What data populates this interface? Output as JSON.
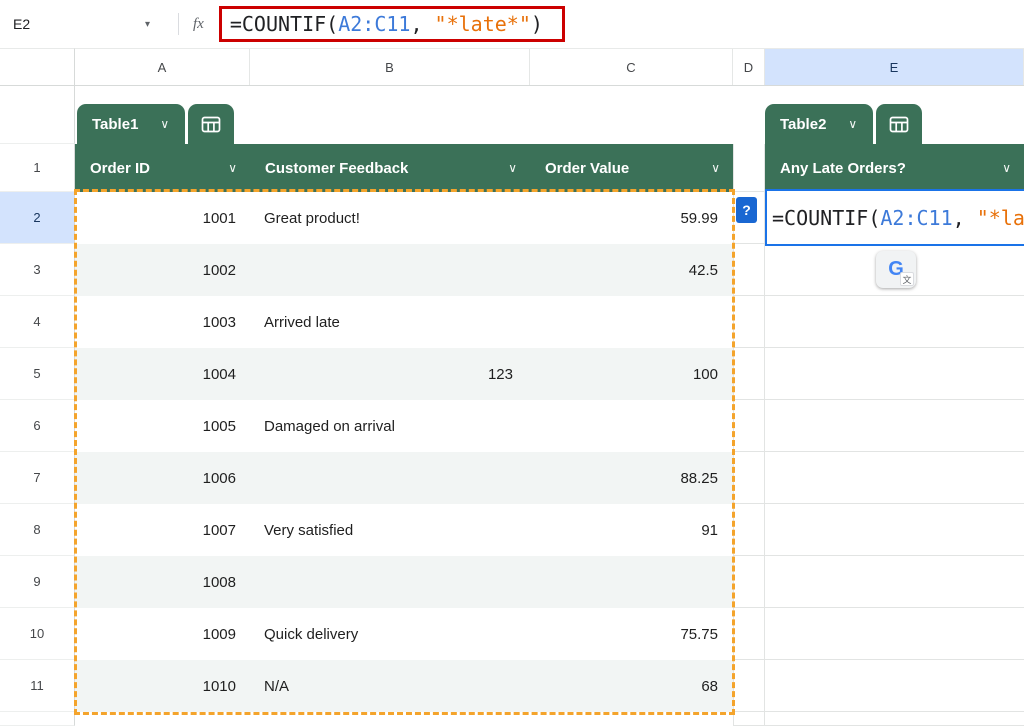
{
  "colors": {
    "table_green": "#3B7158",
    "band": "#F2F5F4",
    "selection_blue": "#1A73E8",
    "header_highlight": "#D3E3FD",
    "marquee_orange": "#F4A42C",
    "annotation_red": "#CC0000",
    "grid_line": "#E2E4E3"
  },
  "icons": {
    "dropdown_caret": "▾",
    "header_chevron": "∨",
    "help_badge": "?",
    "input_tools_letter": "G",
    "input_tools_glyph": "文"
  },
  "formula_bar": {
    "cell_ref": "E2",
    "fx_label": "fx"
  },
  "formula": {
    "full_text": "=COUNTIF(A2:C11, \"*late*\")",
    "tokens": [
      {
        "text": "=COUNTIF(",
        "color": "#202124"
      },
      {
        "text": "A2:C11",
        "color": "#3D7AD9"
      },
      {
        "text": ", ",
        "color": "#202124"
      },
      {
        "text": "\"*late*\"",
        "color": "#E8710A"
      },
      {
        "text": ")",
        "color": "#202124"
      }
    ]
  },
  "sheet": {
    "columns": [
      "A",
      "B",
      "C",
      "D",
      "E"
    ],
    "selected_column": "E",
    "selected_row": "2",
    "first_row_number": "1"
  },
  "table1": {
    "name": "Table1",
    "headers": [
      "Order ID",
      "Customer Feedback",
      "Order Value"
    ]
  },
  "table2": {
    "name": "Table2",
    "header": "Any Late Orders?"
  },
  "rows": [
    {
      "n": "2",
      "order_id": "1001",
      "feedback": "Great product!",
      "value": "59.99"
    },
    {
      "n": "3",
      "order_id": "1002",
      "feedback": "",
      "value": "42.5"
    },
    {
      "n": "4",
      "order_id": "1003",
      "feedback": "Arrived late",
      "value": ""
    },
    {
      "n": "5",
      "order_id": "1004",
      "feedback": "123",
      "value": "100"
    },
    {
      "n": "6",
      "order_id": "1005",
      "feedback": "Damaged on arrival",
      "value": ""
    },
    {
      "n": "7",
      "order_id": "1006",
      "feedback": "",
      "value": "88.25"
    },
    {
      "n": "8",
      "order_id": "1007",
      "feedback": "Very satisfied",
      "value": "91"
    },
    {
      "n": "9",
      "order_id": "1008",
      "feedback": "",
      "value": ""
    },
    {
      "n": "10",
      "order_id": "1009",
      "feedback": "Quick delivery",
      "value": "75.75"
    },
    {
      "n": "11",
      "order_id": "1010",
      "feedback": "N/A",
      "value": "68"
    }
  ]
}
